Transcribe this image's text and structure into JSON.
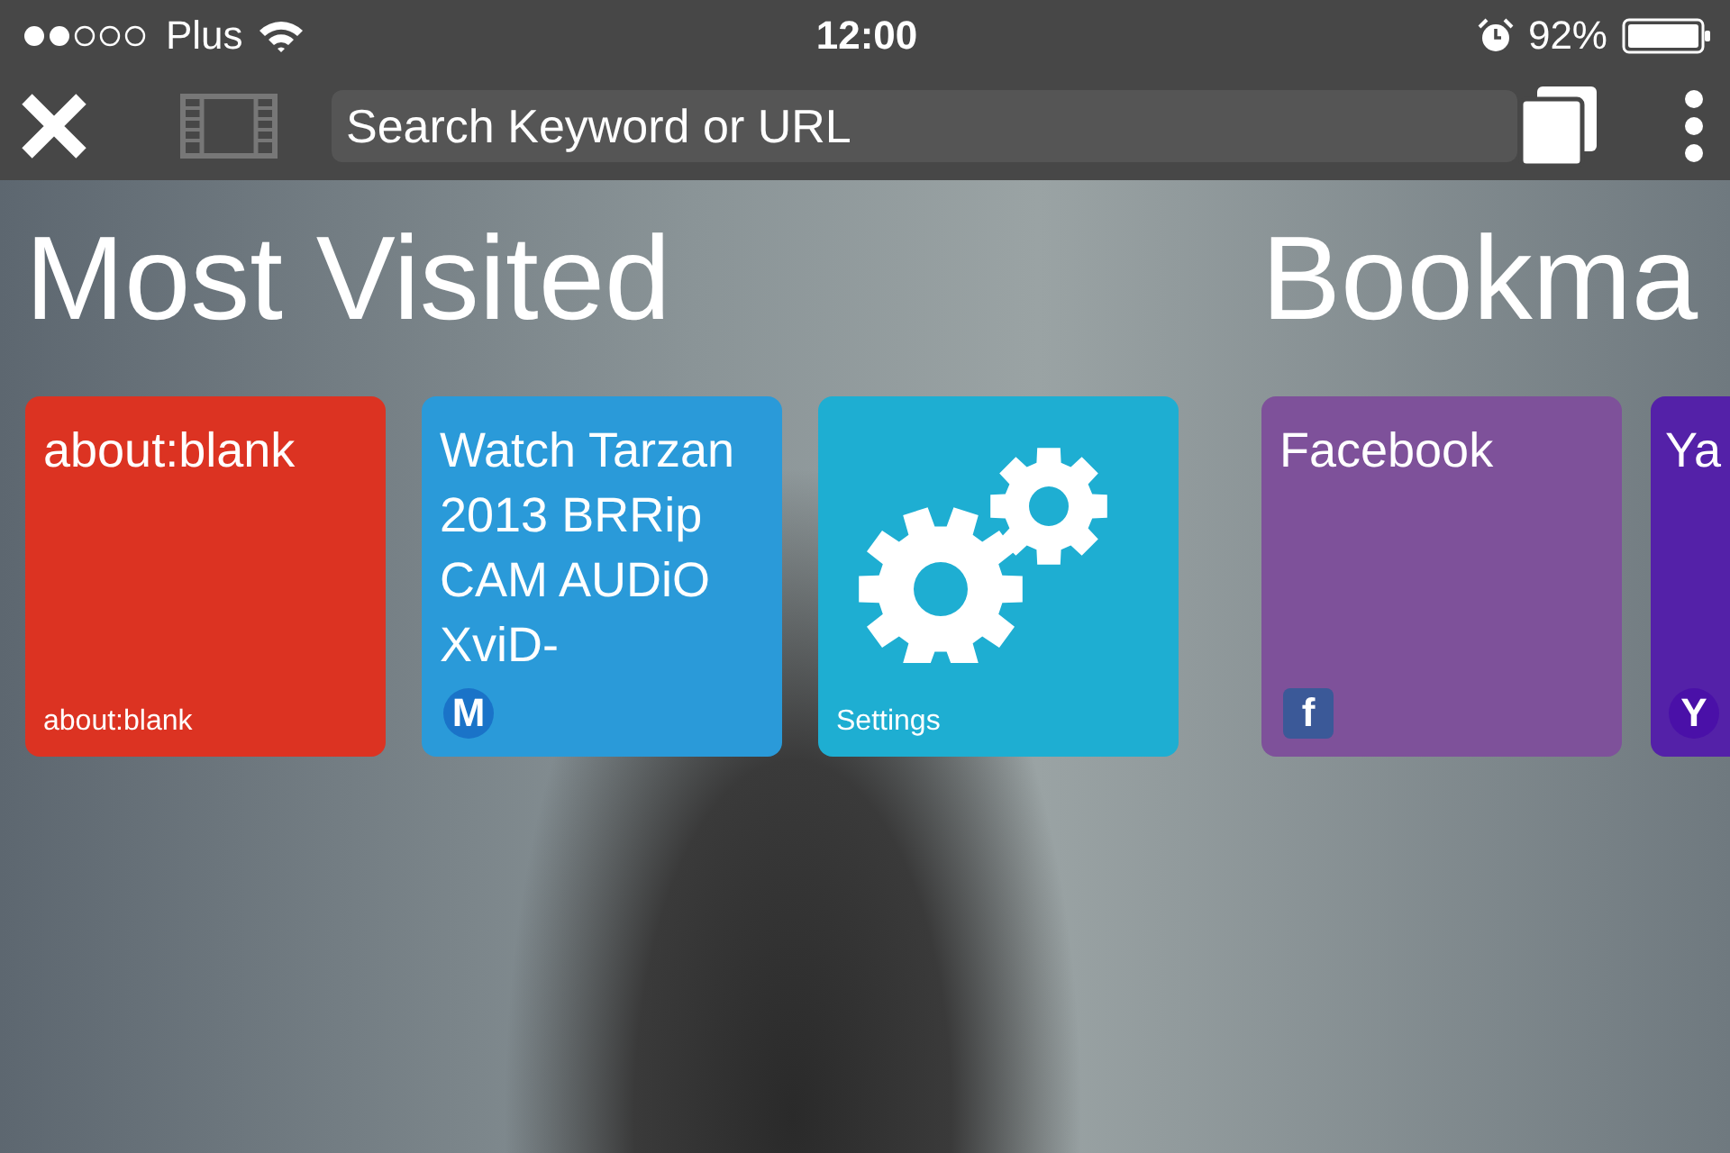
{
  "status_bar": {
    "carrier": "Plus",
    "time": "12:00",
    "battery": "92%"
  },
  "toolbar": {
    "search": {
      "placeholder": "Search Keyword or URL"
    }
  },
  "sections": [
    {
      "title": "Most Visited",
      "tiles": [
        {
          "kind": "page",
          "title": "about:blank",
          "footer": "about:blank",
          "color": "#dc3322"
        },
        {
          "kind": "page",
          "title": "Watch Tarzan 2013 BRRip CAM AUDiO XviD-",
          "badge": {
            "text": "M",
            "color": "#1a73c8"
          },
          "color": "#2a9ad9"
        },
        {
          "kind": "settings",
          "footer": "Settings",
          "color": "#1eaed2"
        }
      ]
    },
    {
      "title": "Bookma",
      "tiles": [
        {
          "kind": "page",
          "title": "Facebook",
          "badge": {
            "text": "f",
            "color": "#3b5998"
          },
          "color": "#7e519a"
        },
        {
          "kind": "page",
          "title": "Ya",
          "badge": {
            "text": "Y",
            "color": "#4a10a8"
          },
          "color": "#5421a8"
        }
      ]
    }
  ]
}
